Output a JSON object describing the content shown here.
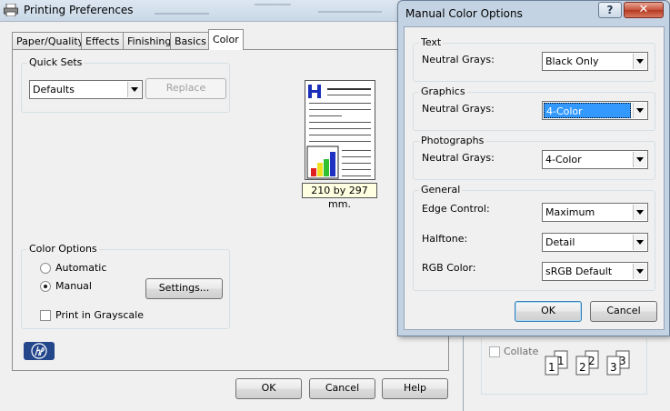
{
  "main_window": {
    "title": "Printing Preferences",
    "tabs": [
      "Paper/Quality",
      "Effects",
      "Finishing",
      "Basics",
      "Color"
    ],
    "active_tab": "Color",
    "quick_sets": {
      "group_label": "Quick Sets",
      "selected": "Defaults",
      "replace_label": "Replace"
    },
    "preview": {
      "caption": "210 by 297 mm."
    },
    "color_options": {
      "group_label": "Color Options",
      "automatic_label": "Automatic",
      "manual_label": "Manual",
      "selected_mode": "Manual",
      "settings_label": "Settings...",
      "grayscale_label": "Print in Grayscale",
      "grayscale_checked": false
    },
    "buttons": {
      "ok": "OK",
      "cancel": "Cancel",
      "help": "Help"
    }
  },
  "behind_window": {
    "collate_label": "Collate",
    "collate_checked": false,
    "copies_icons": [
      "1",
      "1",
      "2",
      "2",
      "3",
      "3"
    ]
  },
  "dialog": {
    "title": "Manual Color Options",
    "help_glyph": "?",
    "close_glyph": "✕",
    "text_group": {
      "label": "Text",
      "field_label": "Neutral Grays:",
      "value": "Black Only"
    },
    "graphics_group": {
      "label": "Graphics",
      "field_label": "Neutral Grays:",
      "value": "4-Color"
    },
    "photographs_group": {
      "label": "Photographs",
      "field_label": "Neutral Grays:",
      "value": "4-Color"
    },
    "general_group": {
      "label": "General",
      "edge_control_label": "Edge Control:",
      "edge_control_value": "Maximum",
      "halftone_label": "Halftone:",
      "halftone_value": "Detail",
      "rgb_color_label": "RGB Color:",
      "rgb_color_value": "sRGB Default"
    },
    "ok_label": "OK",
    "cancel_label": "Cancel"
  },
  "colors": {
    "selection_highlight": "#3399ff",
    "hp_logo": "#24478c",
    "preview_bar_red": "#e02020",
    "preview_bar_yellow": "#f0e020",
    "preview_bar_green": "#30c030",
    "preview_bar_blue": "#2030c0"
  }
}
